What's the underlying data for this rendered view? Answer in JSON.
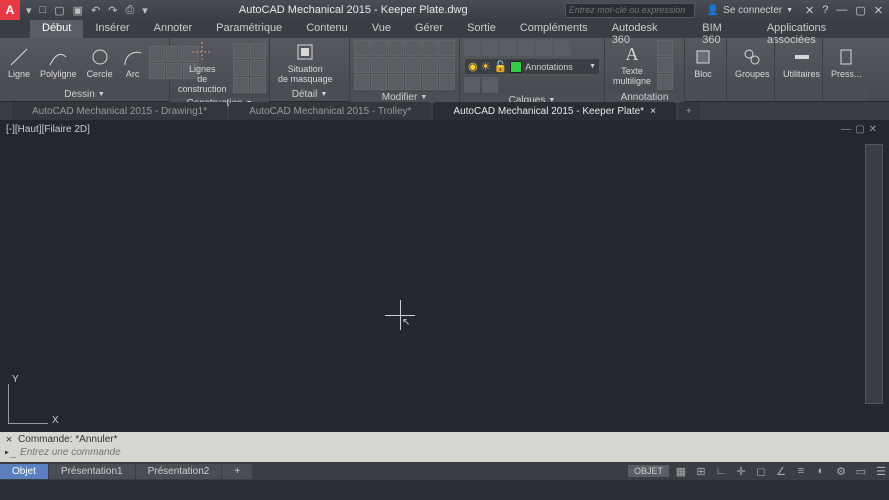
{
  "title": "AutoCAD Mechanical 2015 - Keeper Plate.dwg",
  "search_placeholder": "Entrez mot-clé ou expression",
  "signin": "Se connecter",
  "ribbon_tabs": [
    "Début",
    "Insérer",
    "Annoter",
    "Paramétrique",
    "Contenu",
    "Vue",
    "Gérer",
    "Sortie",
    "Compléments",
    "Autodesk 360",
    "BIM 360",
    "Applications associées"
  ],
  "panels": {
    "dessin": {
      "title": "Dessin",
      "tools": [
        "Ligne",
        "Polyligne",
        "Cercle",
        "Arc"
      ]
    },
    "construction": {
      "title": "Construction",
      "tool": "Lignes\nde construction"
    },
    "detail": {
      "title": "Détail",
      "tool": "Situation\nde masquage"
    },
    "modifier": {
      "title": "Modifier"
    },
    "calques": {
      "title": "Calques",
      "dropdown": "Annotations"
    },
    "annotation": {
      "title": "Annotation",
      "tool": "Texte\nmultiligne"
    },
    "bloc": {
      "title": "",
      "tool": "Bloc"
    },
    "groupes": {
      "title": "",
      "tool": "Groupes"
    },
    "utilitaires": {
      "title": "",
      "tool": "Utilitaires"
    },
    "presse": {
      "title": "",
      "tool": "Press..."
    }
  },
  "doc_tabs": [
    {
      "label": "AutoCAD Mechanical 2015 - Drawing1*"
    },
    {
      "label": "AutoCAD Mechanical 2015 - Trolley*"
    },
    {
      "label": "AutoCAD Mechanical 2015 - Keeper Plate*"
    }
  ],
  "view_label": "[-][Haut][Filaire 2D]",
  "cmd_history": "Commande: *Annuler*",
  "cmd_placeholder": "Entrez une commande",
  "axes": {
    "x": "X",
    "y": "Y"
  },
  "model_tabs": [
    "Objet",
    "Présentation1",
    "Présentation2"
  ],
  "status_right": "OBJET"
}
